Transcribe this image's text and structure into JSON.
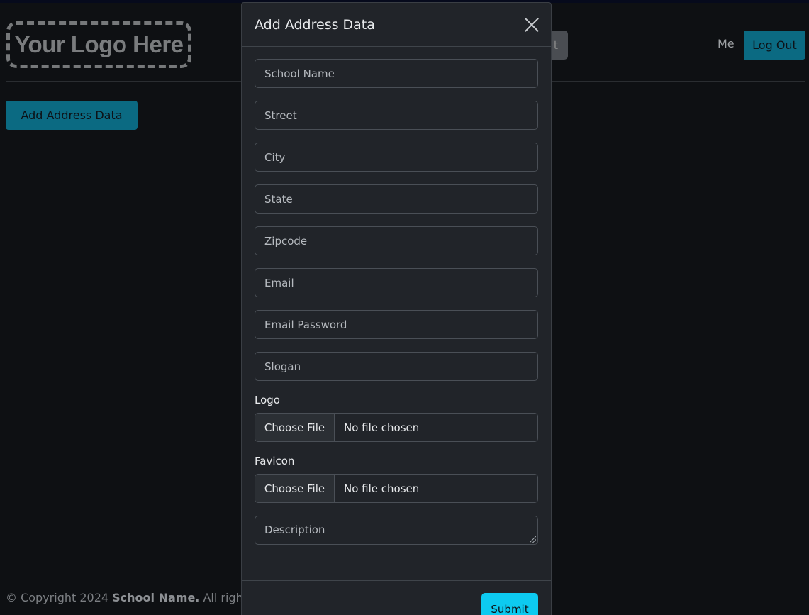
{
  "page": {
    "logo_text": "Your Logo Here",
    "hidden_button_fragment": "t",
    "nav_me": "Me",
    "logout_label": "Log Out",
    "add_button_label": "Add Address Data",
    "footer": {
      "prefix": "© Copyright 2024 ",
      "brand": "School Name.",
      "suffix": " All rights reserved."
    }
  },
  "modal": {
    "title": "Add Address Data",
    "close_icon": "close-icon",
    "fields": [
      {
        "name": "school-name-input",
        "placeholder": "School Name",
        "value": ""
      },
      {
        "name": "street-input",
        "placeholder": "Street",
        "value": ""
      },
      {
        "name": "city-input",
        "placeholder": "City",
        "value": ""
      },
      {
        "name": "state-input",
        "placeholder": "State",
        "value": ""
      },
      {
        "name": "zipcode-input",
        "placeholder": "Zipcode",
        "value": ""
      },
      {
        "name": "email-input",
        "placeholder": "Email",
        "value": ""
      },
      {
        "name": "email-password-input",
        "placeholder": "Email Password",
        "value": ""
      },
      {
        "name": "slogan-input",
        "placeholder": "Slogan",
        "value": ""
      }
    ],
    "logo_field": {
      "label": "Logo",
      "button": "Choose File",
      "status": "No file chosen"
    },
    "favicon_field": {
      "label": "Favicon",
      "button": "Choose File",
      "status": "No file chosen"
    },
    "description": {
      "placeholder": "Description",
      "value": ""
    },
    "submit_label": "Submit"
  },
  "colors": {
    "background": "#0e1013",
    "modal_bg": "#212429",
    "accent": "#0dcaf0",
    "dim_accent": "#0b6a82"
  }
}
